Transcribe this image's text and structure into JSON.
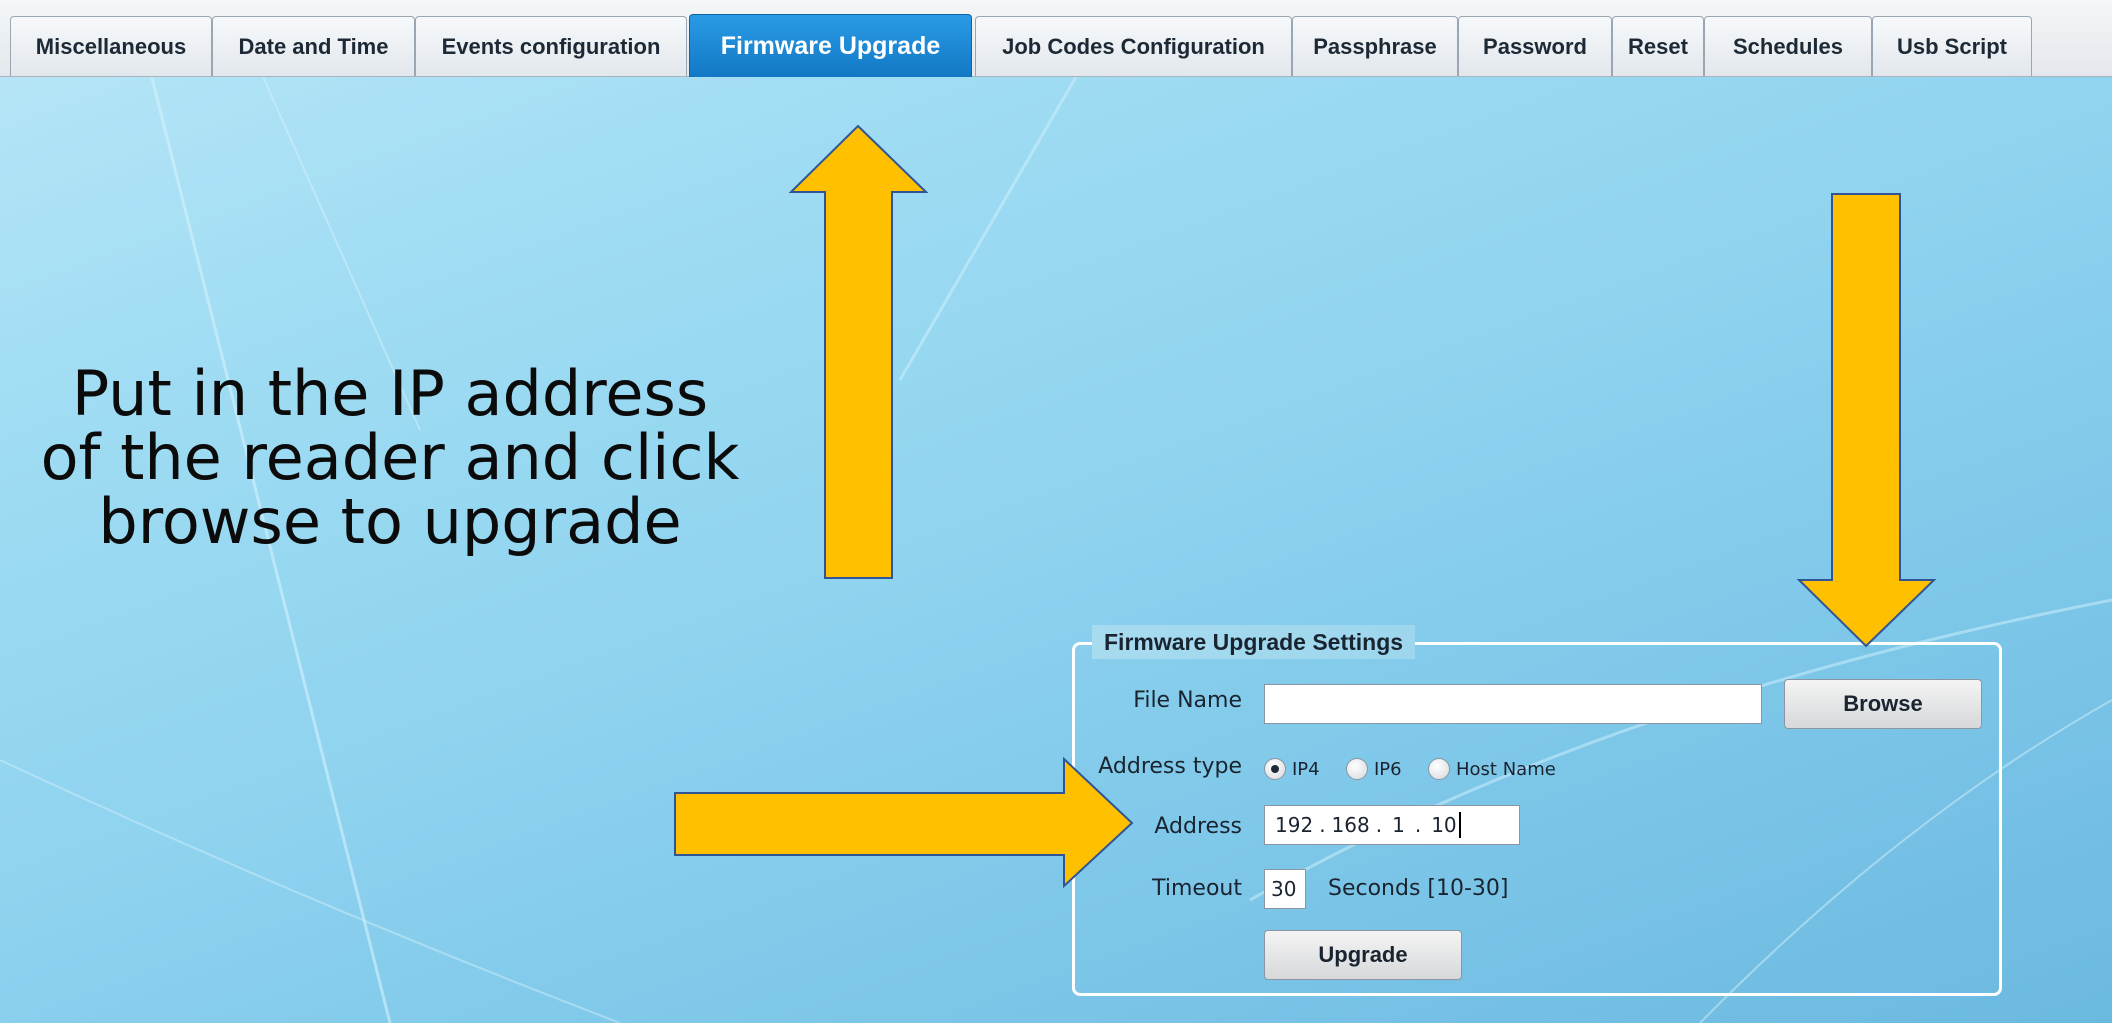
{
  "tabs": [
    {
      "label": "Miscellaneous",
      "active": false
    },
    {
      "label": "Date and Time",
      "active": false
    },
    {
      "label": "Events configuration",
      "active": false
    },
    {
      "label": "Firmware Upgrade",
      "active": true
    },
    {
      "label": "Job Codes Configuration",
      "active": false
    },
    {
      "label": "Passphrase",
      "active": false
    },
    {
      "label": "Password",
      "active": false
    },
    {
      "label": "Reset",
      "active": false
    },
    {
      "label": "Schedules",
      "active": false
    },
    {
      "label": "Usb Script",
      "active": false
    }
  ],
  "instruction": {
    "line1": "Put in the IP address",
    "line2": "of the reader and click",
    "line3": "browse to upgrade"
  },
  "firmware": {
    "legend": "Firmware Upgrade Settings",
    "file_name_label": "File Name",
    "file_name_value": "",
    "browse_label": "Browse",
    "address_type_label": "Address type",
    "address_types": [
      {
        "label": "IP4",
        "selected": true
      },
      {
        "label": "IP6",
        "selected": false
      },
      {
        "label": "Host Name",
        "selected": false
      }
    ],
    "address_label": "Address",
    "address_octets": [
      "192",
      "168",
      "1",
      "10"
    ],
    "address_separator": ".",
    "timeout_label": "Timeout",
    "timeout_value": "30",
    "timeout_unit": "Seconds [10-30]",
    "upgrade_label": "Upgrade"
  },
  "colors": {
    "arrow_fill": "#ffc000",
    "arrow_stroke": "#2f5597",
    "active_tab": "#1a86d6"
  }
}
